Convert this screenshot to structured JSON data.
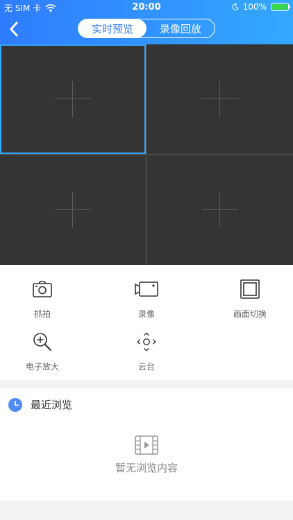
{
  "status_bar": {
    "carrier": "无 SIM 卡",
    "time": "20:00",
    "battery": "100%",
    "icons": [
      "wifi-icon",
      "moon-icon",
      "battery-icon"
    ]
  },
  "header": {
    "tabs": [
      {
        "label": "实时预览",
        "active": true
      },
      {
        "label": "录像回放",
        "active": false
      }
    ]
  },
  "grid": {
    "cells": [
      {
        "name": "video-slot-1",
        "selected": true
      },
      {
        "name": "video-slot-2",
        "selected": false
      },
      {
        "name": "video-slot-3",
        "selected": false
      },
      {
        "name": "video-slot-4",
        "selected": false
      }
    ]
  },
  "controls": [
    {
      "label": "抓拍",
      "icon": "camera-icon"
    },
    {
      "label": "录像",
      "icon": "video-camera-icon"
    },
    {
      "label": "画面切换",
      "icon": "layout-switch-icon"
    },
    {
      "label": "电子放大",
      "icon": "zoom-in-icon"
    },
    {
      "label": "云台",
      "icon": "ptz-icon"
    }
  ],
  "recent": {
    "title": "最近浏览",
    "empty_text": "暂无浏览内容"
  },
  "colors": {
    "header_start": "#2f7cff",
    "header_end": "#33a8ff",
    "selection": "#33a8ff",
    "cell_bg": "#343434"
  }
}
